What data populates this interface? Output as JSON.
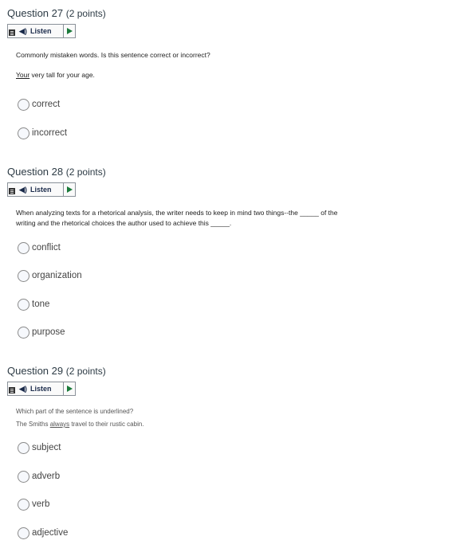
{
  "listen_widget": {
    "label": "Listen",
    "speaker_icon": "speaker-icon",
    "play_icon": "play-icon",
    "menu_icon": "menu-icon"
  },
  "questions": [
    {
      "title": "Question 27",
      "points": "(2 points)",
      "prompt_line1": "Commonly mistaken words. Is this sentence correct or incorrect?",
      "prompt_line2_underlined": "Your",
      "prompt_line2_rest": " very tall for your age.",
      "options": [
        "correct",
        "incorrect"
      ]
    },
    {
      "title": "Question 28",
      "points": "(2 points)",
      "prompt_line1": "When analyzing texts for a rhetorical analysis, the writer needs to keep in mind two things--the _____ of the",
      "prompt_line2": "writing and the rhetorical choices the author used to achieve this _____.",
      "options": [
        "conflict",
        "organization",
        "tone",
        "purpose"
      ]
    },
    {
      "title": "Question 29",
      "points": "(2 points)",
      "prompt_line1": "Which part of the sentence is underlined?",
      "prompt_line2_pre": "The Smiths ",
      "prompt_line2_underlined": "always",
      "prompt_line2_post": " travel to their rustic cabin.",
      "options": [
        "subject",
        "adverb",
        "verb",
        "adjective"
      ]
    }
  ]
}
